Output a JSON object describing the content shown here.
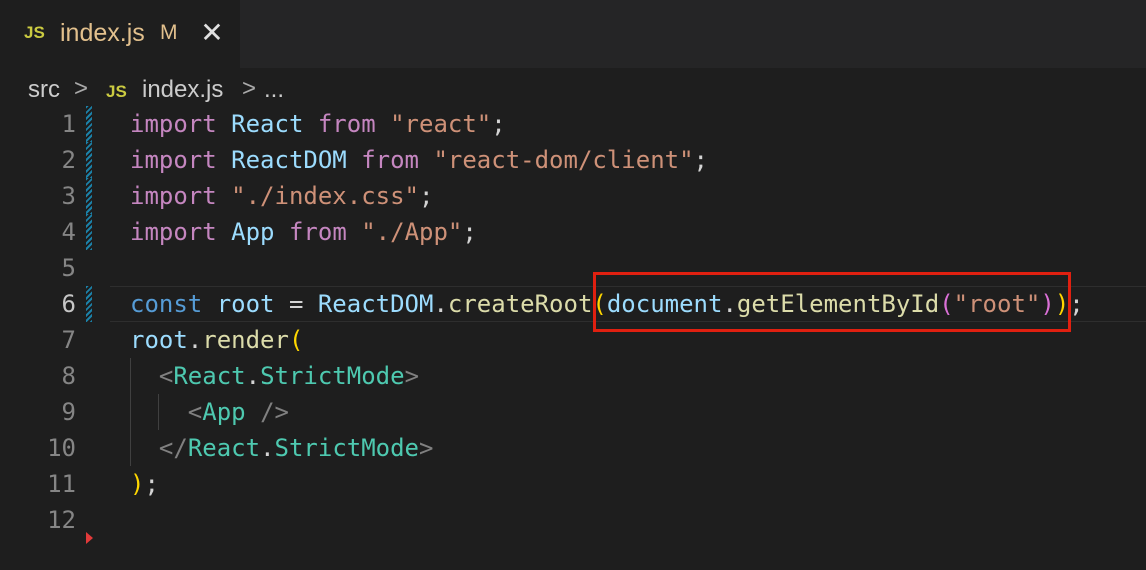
{
  "tab": {
    "lang_badge": "JS",
    "filename": "index.js",
    "status": "M",
    "close_glyph": "✕"
  },
  "breadcrumb": {
    "folder": "src",
    "separator": ">",
    "lang_badge": "JS",
    "file": "index.js",
    "more": "..."
  },
  "editor": {
    "active_line": 6,
    "line_numbers": [
      "1",
      "2",
      "3",
      "4",
      "5",
      "6",
      "7",
      "8",
      "9",
      "10",
      "11",
      "12"
    ],
    "highlighted_snippet": "document.getElementById(\"root\"))"
  },
  "colors": {
    "background": "#1e1e1e",
    "keyword": "#c586c0",
    "storage": "#569cd6",
    "variable": "#9cdcfe",
    "string": "#ce9178",
    "function": "#dcdcaa",
    "class": "#4ec9b0",
    "highlight_box": "#e02010"
  }
}
